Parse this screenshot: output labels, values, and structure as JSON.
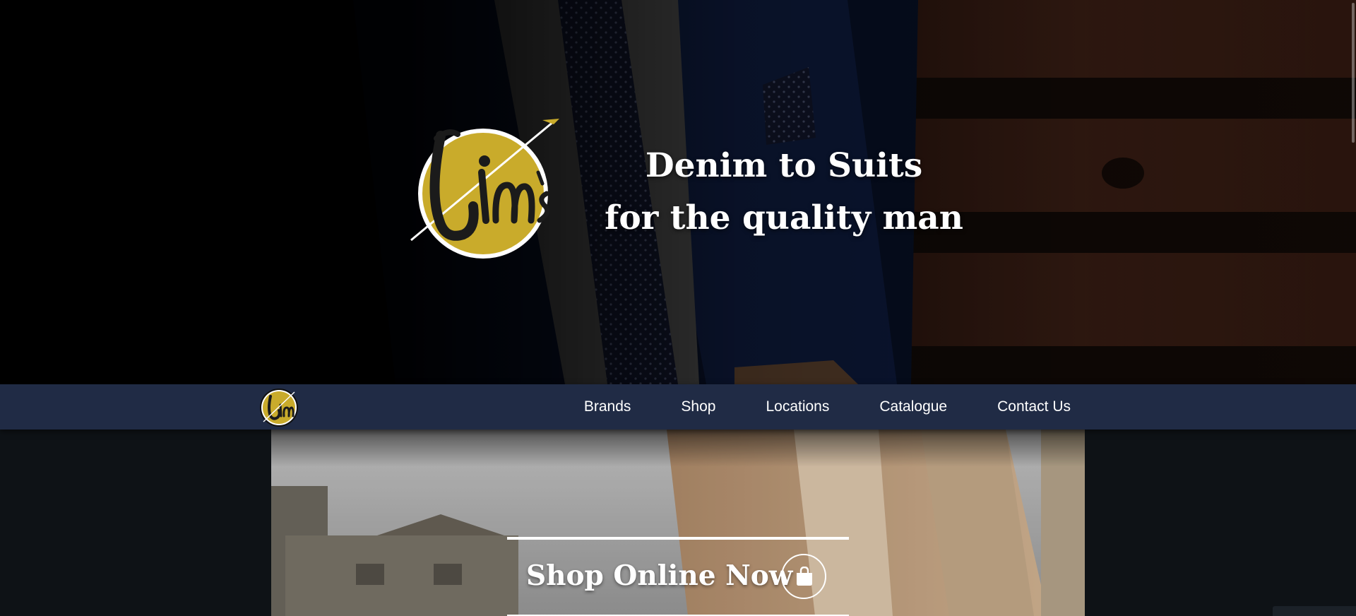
{
  "brand": {
    "logo_text": "Jim's",
    "logo_color": "#c9ab2b"
  },
  "hero": {
    "tagline_line1": "Denim to Suits",
    "tagline_line2": "for the quality man"
  },
  "nav": {
    "items": [
      {
        "label": "Brands"
      },
      {
        "label": "Shop"
      },
      {
        "label": "Locations"
      },
      {
        "label": "Catalogue"
      },
      {
        "label": "Contact Us"
      }
    ],
    "background": "#202b45"
  },
  "cta": {
    "label": "Shop Online Now",
    "icon": "shopping-bag-icon"
  }
}
